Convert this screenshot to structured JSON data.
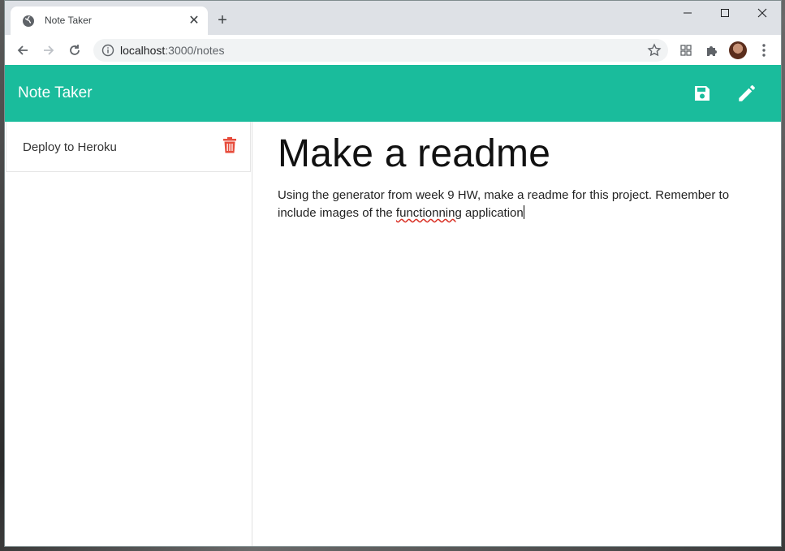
{
  "browser": {
    "tab_title": "Note Taker",
    "url_host": "localhost",
    "url_path": ":3000/notes"
  },
  "app": {
    "brand": "Note Taker",
    "accent": "#1abc9c",
    "save_icon": "save-icon",
    "new_icon": "pencil-icon"
  },
  "sidebar": {
    "notes": [
      {
        "title": "Deploy to Heroku",
        "delete_icon": "trash-icon",
        "delete_color": "#e74c3c"
      }
    ]
  },
  "editor": {
    "title": "Make a readme",
    "body_before": "Using the generator from week 9 HW, make a readme for this project. Remember to include images of the ",
    "body_misspelled": "functionning",
    "body_after": " application"
  }
}
